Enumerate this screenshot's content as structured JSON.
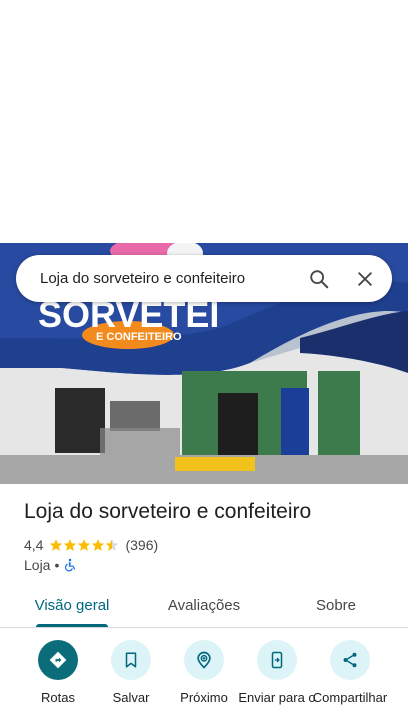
{
  "search": {
    "query": "Loja do sorveteiro e confeiteiro"
  },
  "photo": {
    "sign_main": "SORVETEI",
    "sign_sub": "E CONFEITEIRO"
  },
  "place": {
    "title": "Loja do sorveteiro e confeiteiro",
    "rating": "4,4",
    "rating_value": 4.4,
    "reviews": "(396)",
    "category": "Loja",
    "separator": "•"
  },
  "tabs": [
    {
      "label": "Visão geral",
      "active": true
    },
    {
      "label": "Avaliações",
      "active": false
    },
    {
      "label": "Sobre",
      "active": false
    }
  ],
  "actions": [
    {
      "label": "Rotas",
      "icon": "directions-icon"
    },
    {
      "label": "Salvar",
      "icon": "bookmark-icon"
    },
    {
      "label": "Próximo",
      "icon": "nearby-icon"
    },
    {
      "label": "Enviar para o",
      "icon": "send-to-phone-icon"
    },
    {
      "label": "Compartilhar",
      "icon": "share-icon"
    }
  ],
  "colors": {
    "accent": "#00677d",
    "primary_button": "#0b6d7a",
    "tonal_button": "#dcf3f7",
    "star": "#fbbc04"
  }
}
